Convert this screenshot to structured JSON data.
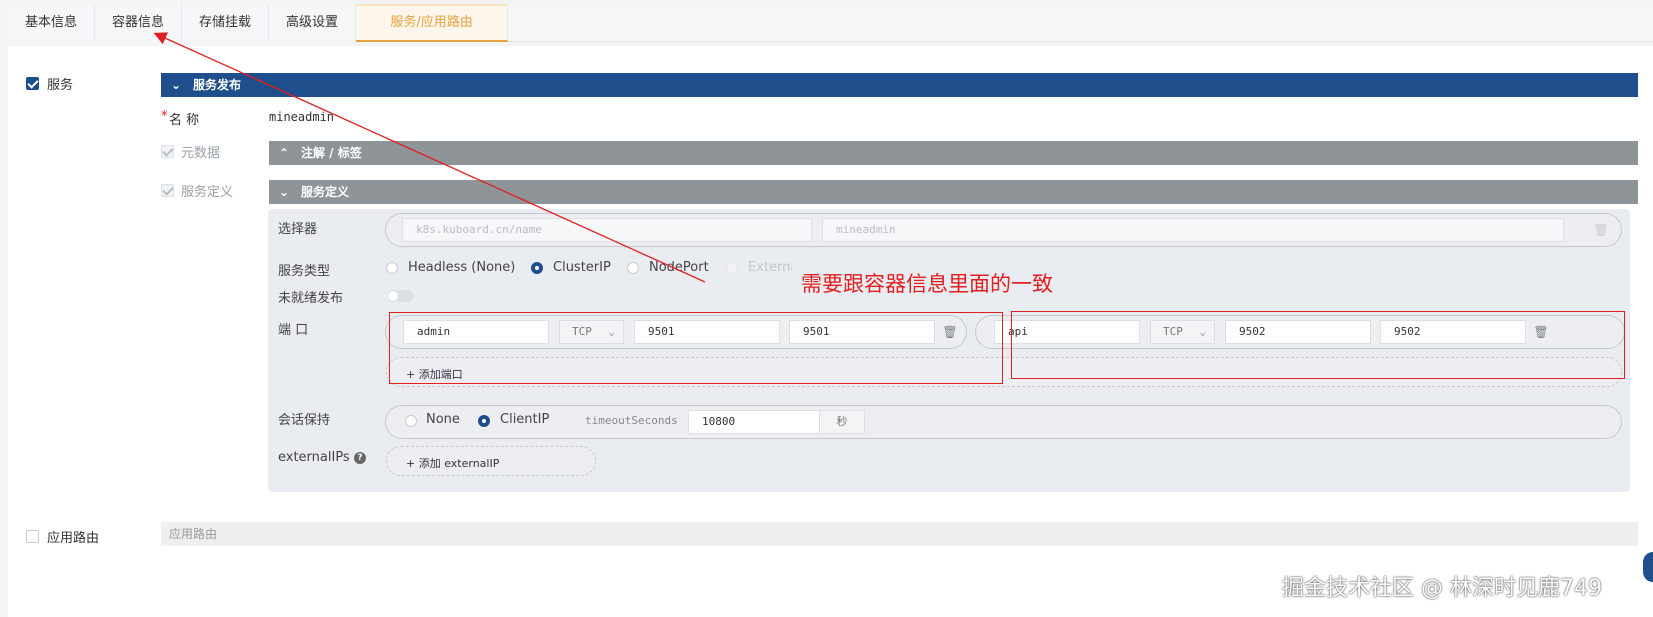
{
  "tabs": [
    "基本信息",
    "容器信息",
    "存储挂载",
    "高级设置",
    "服务/应用路由"
  ],
  "service": {
    "checkbox_label": "服务",
    "publish_bar": "服务发布",
    "name_label": "名 称",
    "name_required": "*",
    "name_value": "mineadmin",
    "metadata_label": "元数据",
    "annotations_bar": "注解 / 标签",
    "definition_label": "服务定义",
    "definition_bar": "服务定义"
  },
  "definition": {
    "selector_label": "选择器",
    "selector_key_placeholder": "k8s.kuboard.cn/name",
    "selector_value_placeholder": "mineadmin",
    "type_label": "服务类型",
    "types": [
      "Headless (None)",
      "ClusterIP",
      "NodePort",
      "ExternalName"
    ],
    "type_selected": "ClusterIP",
    "unready_label": "未就绪发布",
    "port_label": "端 口",
    "ports": [
      {
        "name": "admin",
        "protocol": "TCP",
        "port": "9501",
        "target": "9501"
      },
      {
        "name": "api",
        "protocol": "TCP",
        "port": "9502",
        "target": "9502"
      }
    ],
    "add_port": "添加端口",
    "session_label": "会话保持",
    "session_options": [
      "None",
      "ClientIP"
    ],
    "session_selected": "ClientIP",
    "timeout_label": "timeoutSeconds",
    "timeout_value": "10800",
    "timeout_unit": "秒",
    "external_label": "externalIPs",
    "add_external": "添加 externalIP"
  },
  "route": {
    "checkbox_label": "应用路由",
    "bar": "应用路由"
  },
  "annotation": {
    "text": "需要跟容器信息里面的一致"
  },
  "watermark": "掘金技术社区 @ 林深时见鹿749",
  "colors": {
    "accent": "#1f4e8c",
    "tab_active": "#e6a23c",
    "annotation": "#e02020"
  }
}
